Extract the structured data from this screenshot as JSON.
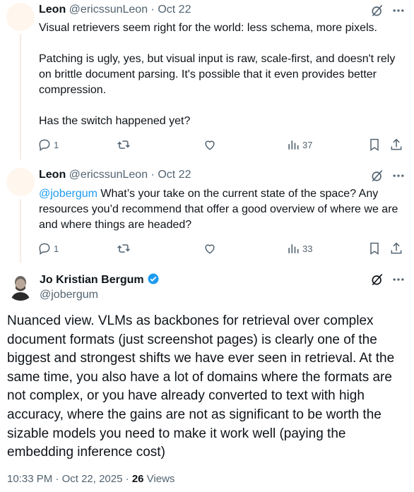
{
  "reply1": {
    "name": "Leon",
    "handle": "@ericssunLeon",
    "sep": "·",
    "date": "Oct 22",
    "text": "Visual retrievers seem right for the world: less schema, more pixels.\n\nPatching is ugly, yes, but visual input is raw, scale-first, and doesn't rely on brittle document parsing. It's possible that it even provides better compression.\n\nHas the switch happened yet?",
    "replies": "1",
    "views": "37"
  },
  "reply2": {
    "name": "Leon",
    "handle": "@ericssunLeon",
    "sep": "·",
    "date": "Oct 22",
    "mention": "@jobergum",
    "text": " What’s your take on the current state of the space? Any resources you’d recommend that offer a good overview of where we are and where things are headed?",
    "replies": "1",
    "views": "33"
  },
  "main": {
    "name": "Jo Kristian Bergum",
    "handle": "@jobergum",
    "text": "Nuanced view.  VLMs as backbones for retrieval over complex document formats (just screenshot pages) is clearly one of the biggest and strongest shifts we have ever seen in retrieval. At the same time, you also have a lot of domains where the formats are not complex, or you have already converted to text with high accuracy, where the gains are not as significant to be worth the sizable models you need to make it work well (paying the embedding inference cost)",
    "time": "10:33 PM",
    "sep1": "·",
    "date": "Oct 22, 2025",
    "sep2": "·",
    "views_count": "26",
    "views_label": "Views"
  },
  "colors": {
    "accent": "#1d9bf0",
    "muted": "#536471",
    "text": "#0f1419"
  }
}
